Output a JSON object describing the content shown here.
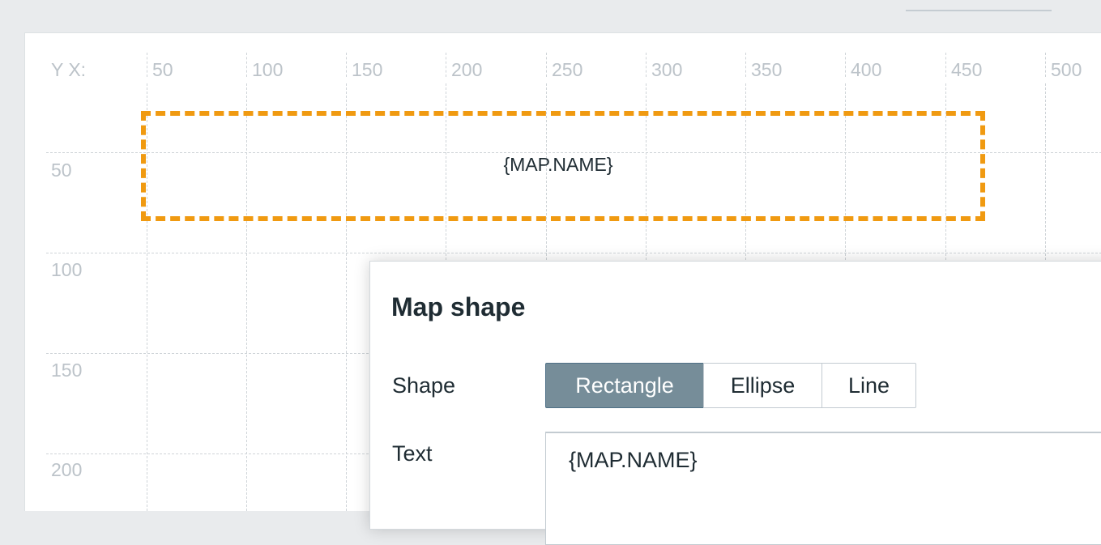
{
  "map": {
    "axis_corner_label": "Y X:",
    "x_ticks": [
      "50",
      "100",
      "150",
      "200",
      "250",
      "300",
      "350",
      "400",
      "450",
      "500"
    ],
    "y_ticks": [
      "50",
      "100",
      "150",
      "200"
    ],
    "selected_shape_text": "{MAP.NAME}",
    "selection_color": "#f09a11"
  },
  "dialog": {
    "title": "Map shape",
    "shape_label": "Shape",
    "shape_options": [
      "Rectangle",
      "Ellipse",
      "Line"
    ],
    "shape_selected": "Rectangle",
    "text_label": "Text",
    "text_value": "{MAP.NAME}"
  }
}
